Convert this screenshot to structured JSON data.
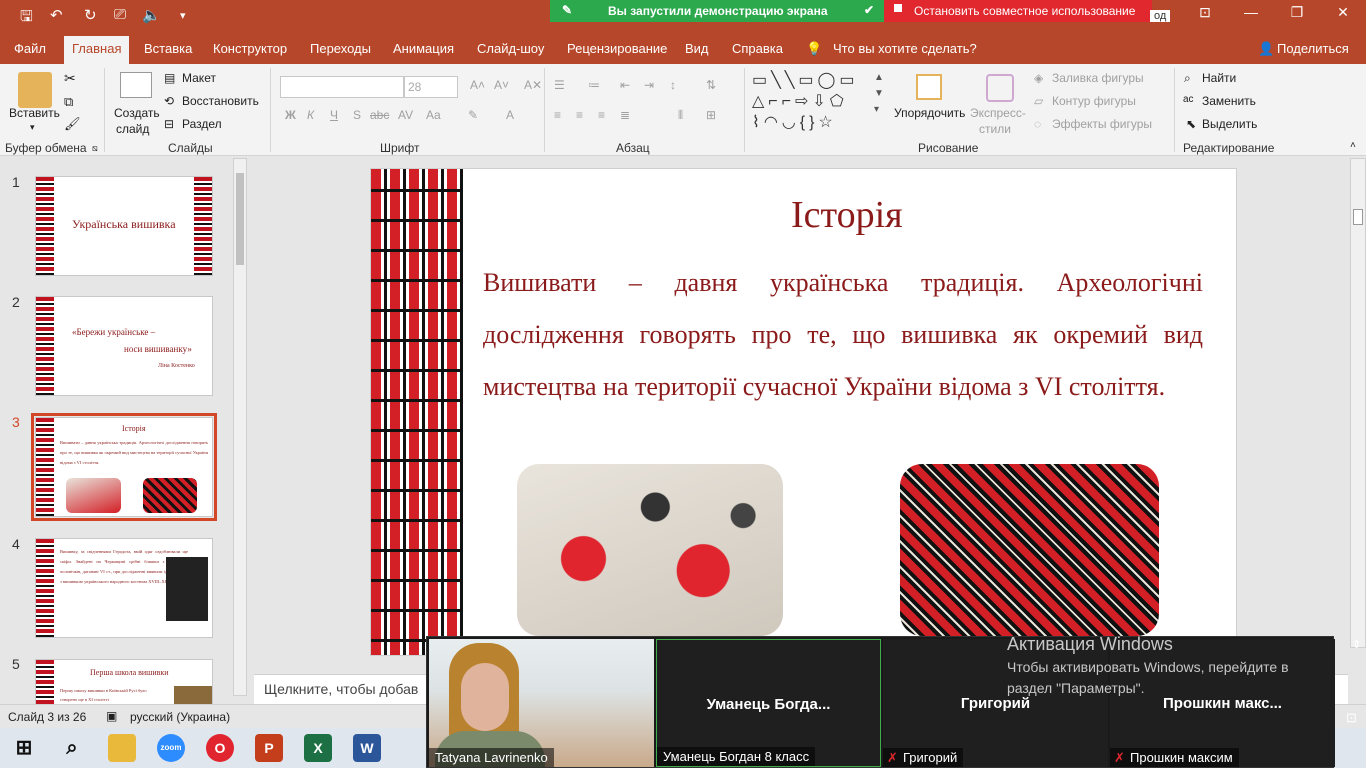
{
  "titlebar": {
    "share_active": "Вы запустили демонстрацию экрана",
    "share_stop": "Остановить совместное использование",
    "hidden_text": "од"
  },
  "menu": {
    "tabs": [
      "Файл",
      "Главная",
      "Вставка",
      "Конструктор",
      "Переходы",
      "Анимация",
      "Слайд-шоу",
      "Рецензирование",
      "Вид",
      "Справка"
    ],
    "active_tab": "Главная",
    "tell_me": "Что вы хотите сделать?",
    "share": "Поделиться"
  },
  "ribbon": {
    "clipboard": {
      "paste": "Вставить",
      "label": "Буфер обмена"
    },
    "slides": {
      "new_slide_line1": "Создать",
      "new_slide_line2": "слайд",
      "layout": "Макет",
      "reset": "Восстановить",
      "section": "Раздел",
      "label": "Слайды"
    },
    "font": {
      "size": "28",
      "label": "Шрифт",
      "bold": "Ж",
      "italic": "К",
      "underline": "Ч",
      "shadow": "S",
      "strike": "abc",
      "aa": "Aa",
      "a": "A"
    },
    "paragraph": {
      "label": "Абзац"
    },
    "drawing": {
      "arrange": "Упорядочить",
      "quick_styles_line1": "Экспресс-",
      "quick_styles_line2": "стили",
      "fill": "Заливка фигуры",
      "outline": "Контур фигуры",
      "effects": "Эффекты фигуры",
      "label": "Рисование"
    },
    "editing": {
      "find": "Найти",
      "replace": "Заменить",
      "select": "Выделить",
      "label": "Редактирование"
    }
  },
  "thumbnails": [
    {
      "num": "1",
      "title": "Українська вишивка"
    },
    {
      "num": "2",
      "quote1": "«Бережи українське –",
      "quote2": "носи вишиванку»",
      "author": "Ліна Костенко"
    },
    {
      "num": "3",
      "title": "Історія",
      "text": "Вишивати – давня українська традиція. Археологічні дослідження говорять про те, що вишивка як окремий вид мистецтва на території сучасної України відома з VI століття."
    },
    {
      "num": "4",
      "text": "Вишивку, за свідченнями Геродота, вмій одяг оздоблювали ще скіфи. Знайдені на Черкащині срібні бляшки з фігурками чоловічків, датовані VI ст., при дослідженні виявили ідентичність з вишивкою українського народного костюма XVIII–XIX ст."
    },
    {
      "num": "5",
      "title": "Перша школа вишивки",
      "text": "Першу школу вишивки в Київській Русі було створено ще в XI столітті"
    }
  ],
  "slide": {
    "title": "Історія",
    "body": "Вишивати – давня українська традиція. Археологічні дослідження говорять про те, що вишивка як окремий вид мистецтва на території сучасної України відома з VI століття."
  },
  "notes": {
    "placeholder": "Щелкните, чтобы добав"
  },
  "status": {
    "slide_of": "Слайд 3 из 26",
    "language": "русский (Украина)"
  },
  "zoom": {
    "tiles": [
      {
        "name": "",
        "label": "Tatyana Lavrinenko"
      },
      {
        "name": "Уманець Богда...",
        "label": "Уманець Богдан 8 класс"
      },
      {
        "name": "Григорий",
        "label": "Григорий"
      },
      {
        "name": "Прошкин макс...",
        "label": "Прошкин максим"
      }
    ]
  },
  "activation": {
    "title": "Активация Windows",
    "text": "Чтобы активировать Windows, перейдите в раздел \"Параметры\"."
  },
  "taskbar": {
    "apps": [
      "start-icon",
      "search-icon",
      "file-explorer-icon",
      "zoom-icon",
      "opera-icon",
      "powerpoint-icon",
      "excel-icon",
      "word-icon"
    ]
  },
  "colors": {
    "accent": "#b7472a",
    "slide_text": "#8b1a1a",
    "share_green": "#2ca84d",
    "share_red": "#e0282e"
  }
}
